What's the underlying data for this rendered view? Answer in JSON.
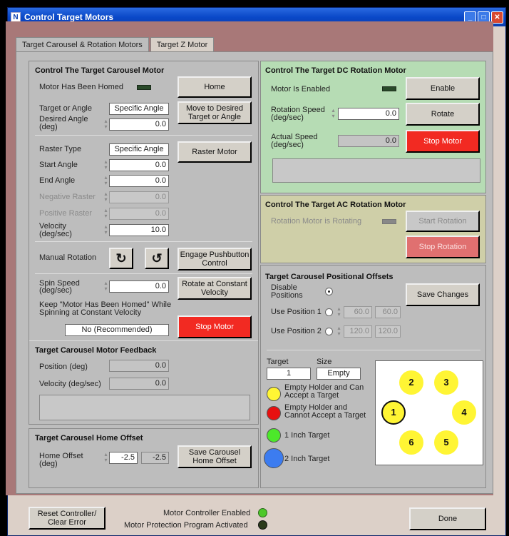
{
  "window": {
    "title": "Control Target Motors",
    "app_icon": "N"
  },
  "tabs": [
    "Target Carousel & Rotation Motors",
    "Target Z Motor"
  ],
  "carousel": {
    "title": "Control The Target Carousel Motor",
    "homed_label": "Motor Has Been Homed",
    "home_btn": "Home",
    "target_or_angle_label": "Target or Angle",
    "target_or_angle_value": "Specific Angle",
    "move_btn": "Move to Desired Target or Angle",
    "desired_angle_label": "Desired Angle (deg)",
    "desired_angle_value": "0.0",
    "raster_type_label": "Raster Type",
    "raster_type_value": "Specific Angle",
    "raster_btn": "Raster Motor",
    "start_angle_label": "Start Angle",
    "start_angle_value": "0.0",
    "end_angle_label": "End Angle",
    "end_angle_value": "0.0",
    "neg_raster_label": "Negative Raster",
    "neg_raster_value": "0.0",
    "pos_raster_label": "Positive Raster",
    "pos_raster_value": "0.0",
    "velocity_label": "Velocity (deg/sec)",
    "velocity_value": "10.0",
    "manual_rotation_label": "Manual Rotation",
    "cw_icon": "↻",
    "ccw_icon": "↺",
    "engage_btn": "Engage Pushbutton Control",
    "spin_speed_label": "Spin Speed (deg/sec)",
    "spin_speed_value": "0.0",
    "rotate_const_btn": "Rotate at Constant Velocity",
    "keep_label": "Keep \"Motor Has Been Homed\" While Spinning at Constant Velocity",
    "keep_value": "No (Recommended)",
    "stop_btn": "Stop Motor"
  },
  "feedback": {
    "title": "Target Carousel Motor Feedback",
    "position_label": "Position  (deg)",
    "position_value": "0.0",
    "velocity_label": "Velocity (deg/sec)",
    "velocity_value": "0.0"
  },
  "home_offset": {
    "title": "Target Carousel Home Offset",
    "label": "Home Offset (deg)",
    "value": "-2.5",
    "readout": "-2.5",
    "save_btn": "Save Carousel Home Offset"
  },
  "dc": {
    "title": "Control The Target DC Rotation Motor",
    "enabled_label": "Motor Is Enabled",
    "enable_btn": "Enable",
    "rot_speed_label": "Rotation Speed (deg/sec)",
    "rot_speed_value": "0.0",
    "rotate_btn": "Rotate",
    "actual_label": "Actual Speed (deg/sec)",
    "actual_value": "0.0",
    "stop_btn": "Stop Motor"
  },
  "ac": {
    "title": "Control The Target AC Rotation Motor",
    "rotating_label": "Rotation Motor is Rotating",
    "start_btn": "Start Rotation",
    "stop_btn": "Stop Rotation"
  },
  "offsets": {
    "title": "Target Carousel Positional Offsets",
    "disable_label": "Disable Positions",
    "pos1_label": "Use Position 1",
    "pos1_a": "60.0",
    "pos1_b": "60.0",
    "pos2_label": "Use Position 2",
    "pos2_a": "120.0",
    "pos2_b": "120.0",
    "save_btn": "Save Changes",
    "target_label": "Target",
    "target_value": "1",
    "size_label": "Size",
    "size_value": "Empty",
    "legend_yellow": "Empty Holder and Can Accept a Target",
    "legend_red": "Empty Holder and Cannot Accept a Target",
    "legend_green": "1 Inch Target",
    "legend_blue": "2 Inch Target",
    "positions": [
      "1",
      "2",
      "3",
      "4",
      "5",
      "6"
    ]
  },
  "bottom": {
    "reset_btn": "Reset Controller/ Clear Error",
    "enabled_label": "Motor Controller Enabled",
    "protection_label": "Motor Protection Program Activated",
    "done_btn": "Done"
  },
  "colors": {
    "green_panel": "#b6dcb4",
    "yellow_panel": "#cfcfa8",
    "stop_red": "#f22a22",
    "position_yellow": "#fff534",
    "led_green": "#4ec82a"
  }
}
